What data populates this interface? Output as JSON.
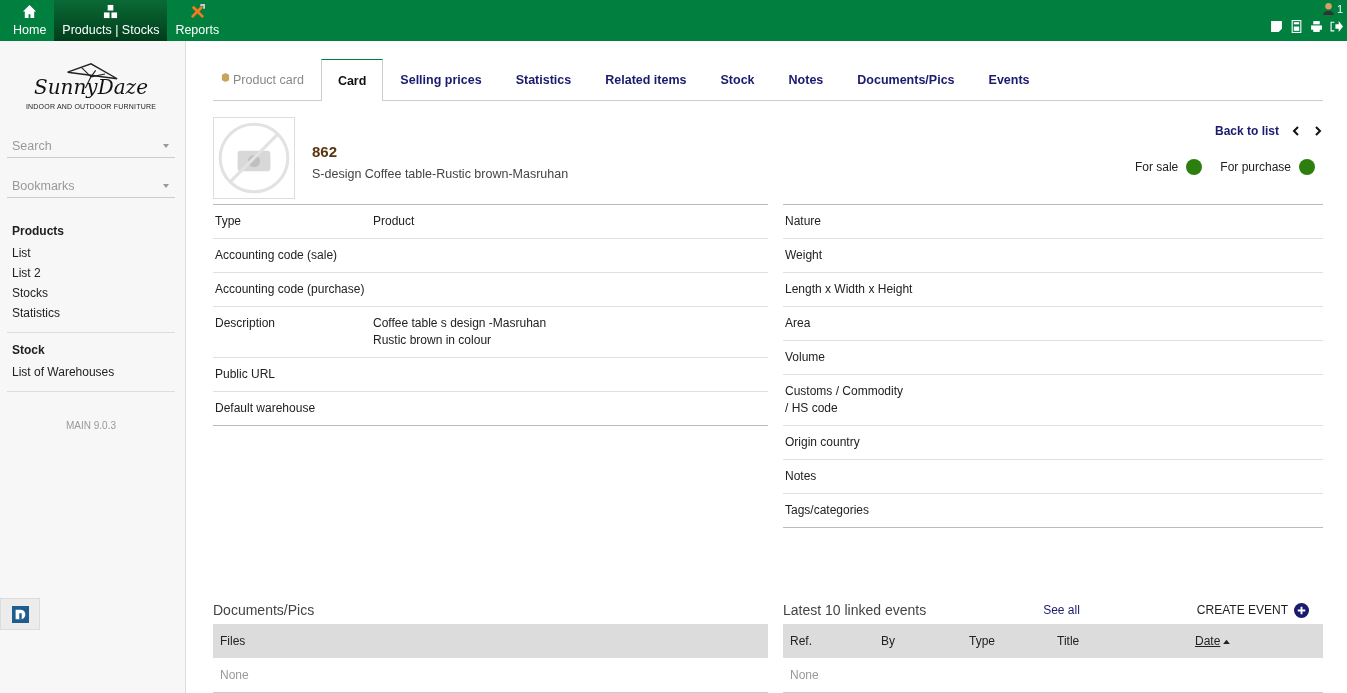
{
  "topbar": {
    "menu": [
      {
        "label": "Home",
        "selected": false
      },
      {
        "label": "Products | Stocks",
        "selected": true
      },
      {
        "label": "Reports",
        "selected": false
      }
    ],
    "user_count": "1"
  },
  "sidebar": {
    "logo": {
      "name": "SunnyDaze",
      "tagline": "INDOOR AND OUTDOOR FURNITURE"
    },
    "search": {
      "placeholder": "Search"
    },
    "bookmarks": {
      "placeholder": "Bookmarks"
    },
    "sections": [
      {
        "title": "Products",
        "items": [
          "List",
          "List 2",
          "Stocks",
          "Statistics"
        ]
      },
      {
        "title": "Stock",
        "items": [
          "List of Warehouses"
        ]
      }
    ],
    "version": "MAIN 9.0.3"
  },
  "tabs": [
    {
      "label": "Product card",
      "kind": "header",
      "selected": false
    },
    {
      "label": "Card",
      "kind": "tab",
      "selected": true
    },
    {
      "label": "Selling prices",
      "kind": "tab",
      "selected": false
    },
    {
      "label": "Statistics",
      "kind": "tab",
      "selected": false
    },
    {
      "label": "Related items",
      "kind": "tab",
      "selected": false
    },
    {
      "label": "Stock",
      "kind": "tab",
      "selected": false
    },
    {
      "label": "Notes",
      "kind": "tab",
      "selected": false
    },
    {
      "label": "Documents/Pics",
      "kind": "tab",
      "selected": false
    },
    {
      "label": "Events",
      "kind": "tab",
      "selected": false
    }
  ],
  "product": {
    "ref": "862",
    "label": "S-design Coffee table-Rustic brown-Masruhan",
    "back_link": "Back to list",
    "statuses": [
      {
        "label": "For sale",
        "on": true
      },
      {
        "label": "For purchase",
        "on": true
      }
    ]
  },
  "left_fields": [
    {
      "label": "Type",
      "value": [
        "Product"
      ]
    },
    {
      "label": "Accounting code (sale)"
    },
    {
      "label": "Accounting code (purchase)"
    },
    {
      "label": "Description",
      "value": [
        "Coffee table s design -Masruhan",
        "Rustic brown in colour"
      ]
    },
    {
      "label": "Public URL"
    },
    {
      "label": "Default warehouse"
    }
  ],
  "right_fields": [
    {
      "label": [
        "Nature"
      ]
    },
    {
      "label": [
        "Weight"
      ]
    },
    {
      "label": [
        "Length x Width x Height"
      ]
    },
    {
      "label": [
        "Area"
      ]
    },
    {
      "label": [
        "Volume"
      ]
    },
    {
      "label": [
        "Customs / Commodity",
        "/ HS code"
      ]
    },
    {
      "label": [
        "Origin country"
      ]
    },
    {
      "label": [
        "Notes"
      ]
    },
    {
      "label": [
        "Tags/categories"
      ]
    }
  ],
  "documents": {
    "title": "Documents/Pics",
    "columns": [
      "Files"
    ],
    "empty": "None"
  },
  "events": {
    "title": "Latest 10 linked events",
    "see_all": "See all",
    "create": "CREATE EVENT",
    "columns": [
      {
        "label": "Ref.",
        "sorted": false
      },
      {
        "label": "By",
        "sorted": false
      },
      {
        "label": "Type",
        "sorted": false
      },
      {
        "label": "Title",
        "sorted": false
      },
      {
        "label": "Date",
        "sorted": true
      }
    ],
    "empty": "None"
  }
}
